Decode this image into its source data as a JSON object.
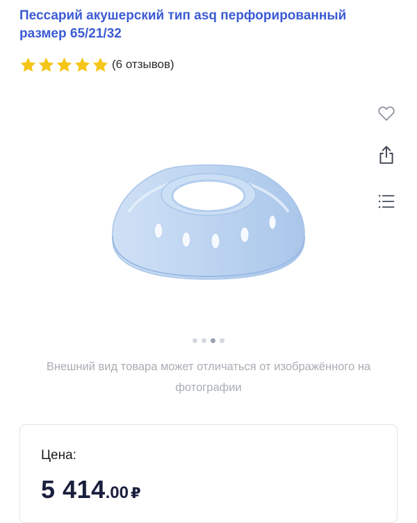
{
  "product": {
    "title": "Пессарий акушерский тип asq перфорированный размер 65/21/32",
    "rating": {
      "stars": 5,
      "reviews_text": "(6 отзывов)"
    }
  },
  "gallery": {
    "image_alt": "blue-silicone-pessary",
    "dots_total": 4,
    "active_dot": 3
  },
  "actions": {
    "favorite_icon": "heart-outline-icon",
    "share_icon": "share-icon",
    "list_icon": "list-icon"
  },
  "disclaimer": "Внешний вид товара может отличаться от изображённого на фотографии",
  "price": {
    "label": "Цена:",
    "integer": "5 414",
    "decimal": ".00",
    "currency": "₽"
  },
  "colors": {
    "title": "#3b5bd4",
    "star": "#f5c518",
    "price": "#1a1f3d",
    "muted": "#a9adb4"
  }
}
